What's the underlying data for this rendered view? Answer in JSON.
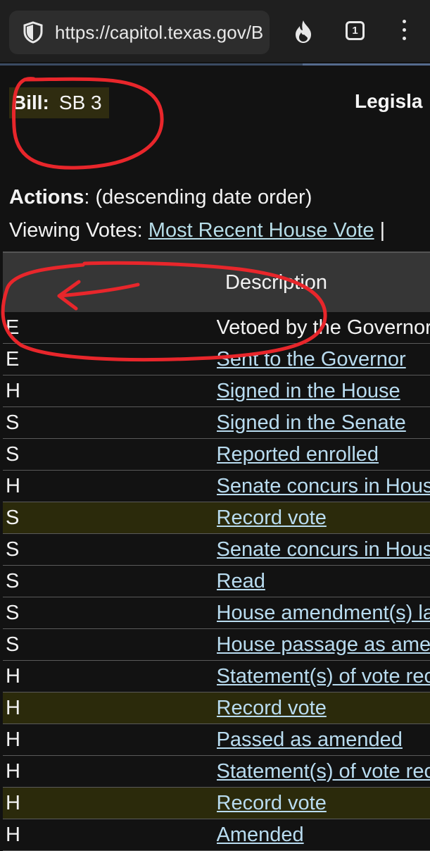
{
  "browser": {
    "url": "https://capitol.texas.gov/B",
    "tab_count": "1"
  },
  "page": {
    "bill_label": "Bill:",
    "bill_value": "SB 3",
    "legislature_label": "Legisla",
    "actions_label": "Actions",
    "actions_suffix": ": (descending date order)",
    "viewing_label": "Viewing Votes:",
    "viewing_link": "Most Recent House Vote",
    "viewing_sep": "|"
  },
  "table": {
    "header": "Description",
    "rows": [
      {
        "chamber": "E",
        "desc": "Vetoed by the Governor",
        "link": false,
        "highlight": false
      },
      {
        "chamber": "E",
        "desc": "Sent to the Governor",
        "link": true,
        "highlight": false
      },
      {
        "chamber": "H",
        "desc": "Signed in the House",
        "link": true,
        "highlight": false
      },
      {
        "chamber": "S",
        "desc": "Signed in the Senate",
        "link": true,
        "highlight": false
      },
      {
        "chamber": "S",
        "desc": "Reported enrolled",
        "link": true,
        "highlight": false
      },
      {
        "chamber": "H",
        "desc": "Senate concurs in House amendment(s",
        "link": true,
        "highlight": false
      },
      {
        "chamber": "S",
        "desc": "Record vote",
        "link": true,
        "highlight": true
      },
      {
        "chamber": "S",
        "desc": "Senate concurs in House amendment(s",
        "link": true,
        "highlight": false
      },
      {
        "chamber": "S",
        "desc": "Read",
        "link": true,
        "highlight": false
      },
      {
        "chamber": "S",
        "desc": "House amendment(s) laid before the S",
        "link": true,
        "highlight": false
      },
      {
        "chamber": "S",
        "desc": "House passage as amended reported",
        "link": true,
        "highlight": false
      },
      {
        "chamber": "H",
        "desc": "Statement(s) of vote recorded in Journ",
        "link": true,
        "highlight": false
      },
      {
        "chamber": "H",
        "desc": "Record vote",
        "link": true,
        "highlight": true
      },
      {
        "chamber": "H",
        "desc": "Passed as amended",
        "link": true,
        "highlight": false
      },
      {
        "chamber": "H",
        "desc": "Statement(s) of vote recorded in Journ",
        "link": true,
        "highlight": false
      },
      {
        "chamber": "H",
        "desc": "Record vote",
        "link": true,
        "highlight": true
      },
      {
        "chamber": "H",
        "desc": "Amended",
        "link": true,
        "highlight": false
      }
    ]
  },
  "colors": {
    "background": "#121212",
    "link": "#b9dcf0",
    "highlight_row": "#2b2a0b",
    "annotation": "#e8262b"
  }
}
